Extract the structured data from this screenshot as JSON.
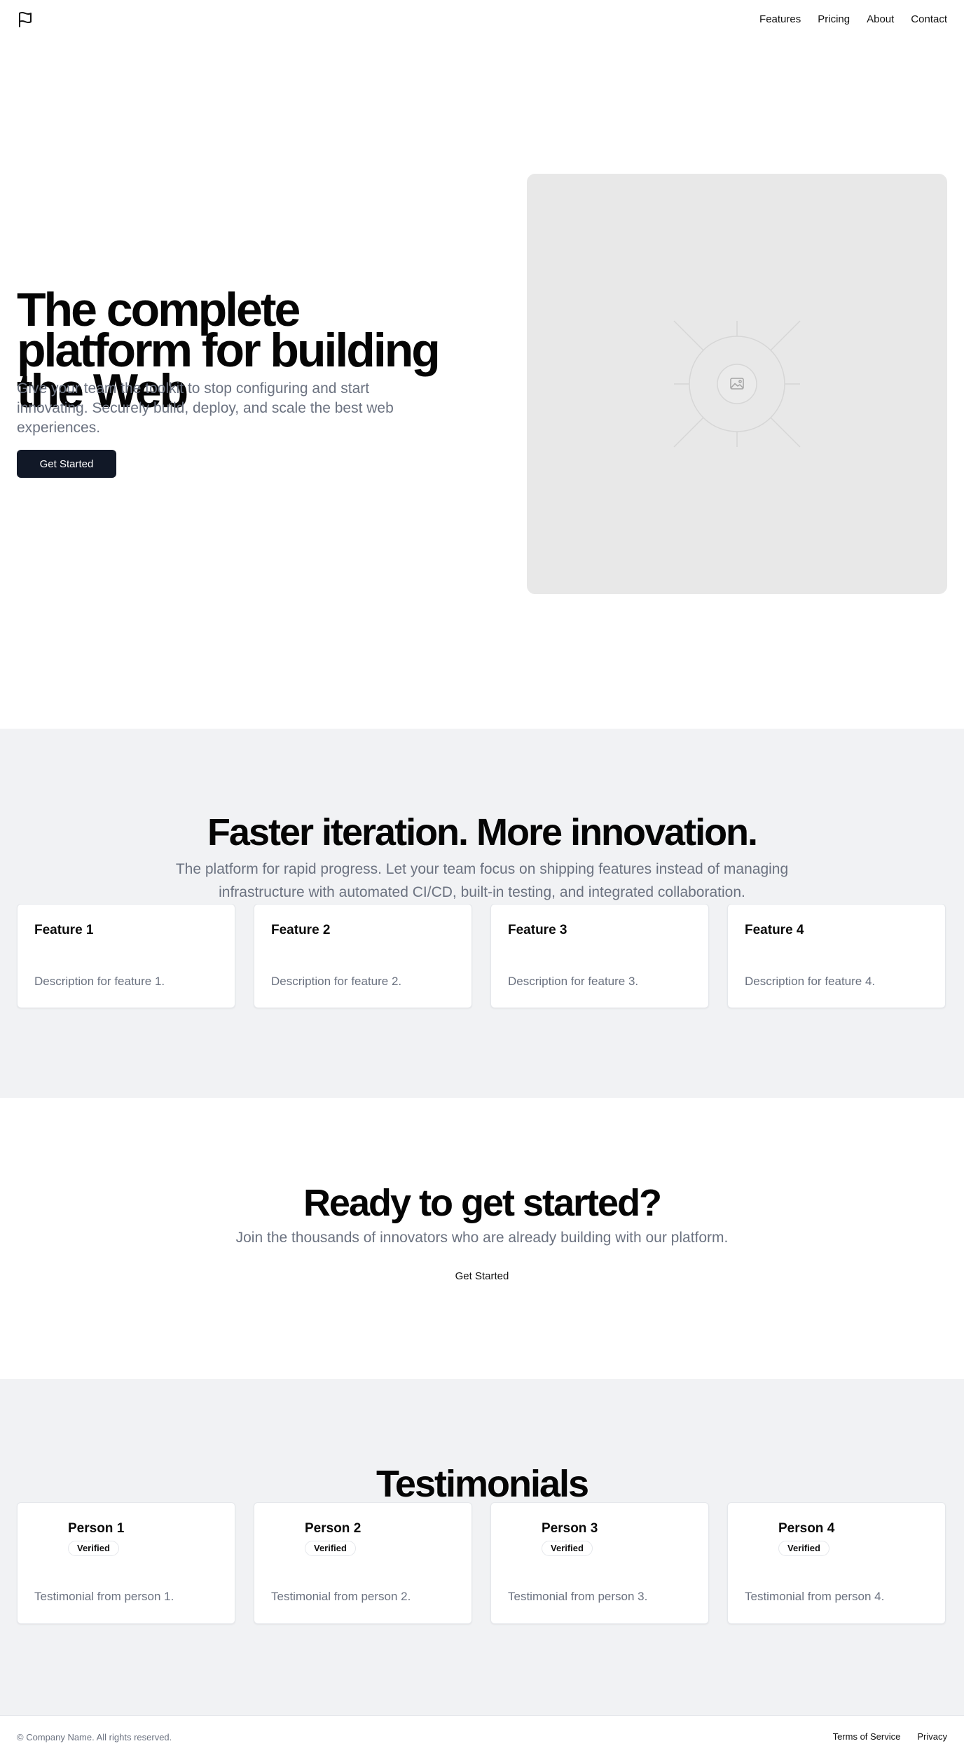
{
  "header": {
    "logo_icon": "flag-icon",
    "nav": [
      "Features",
      "Pricing",
      "About",
      "Contact"
    ]
  },
  "hero": {
    "title": "The complete platform for building the Web",
    "subtitle": "Give your team the toolkit to stop configuring and start innovating. Securely build, deploy, and scale the best web experiences.",
    "cta_label": "Get Started",
    "image_icon": "image-placeholder-icon"
  },
  "features": {
    "title": "Faster iteration. More innovation.",
    "subtitle": "The platform for rapid progress. Let your team focus on shipping features instead of managing infrastructure with automated CI/CD, built-in testing, and integrated collaboration.",
    "items": [
      {
        "title": "Feature 1",
        "description": "Description for feature 1."
      },
      {
        "title": "Feature 2",
        "description": "Description for feature 2."
      },
      {
        "title": "Feature 3",
        "description": "Description for feature 3."
      },
      {
        "title": "Feature 4",
        "description": "Description for feature 4."
      }
    ]
  },
  "cta": {
    "title": "Ready to get started?",
    "subtitle": "Join the thousands of innovators who are already building with our platform.",
    "button_label": "Get Started"
  },
  "testimonials": {
    "title": "Testimonials",
    "items": [
      {
        "name": "Person 1",
        "badge": "Verified",
        "text": "Testimonial from person 1."
      },
      {
        "name": "Person 2",
        "badge": "Verified",
        "text": "Testimonial from person 2."
      },
      {
        "name": "Person 3",
        "badge": "Verified",
        "text": "Testimonial from person 3."
      },
      {
        "name": "Person 4",
        "badge": "Verified",
        "text": "Testimonial from person 4."
      }
    ]
  },
  "footer": {
    "copyright": "© Company Name. All rights reserved.",
    "links": [
      "Terms of Service",
      "Privacy"
    ]
  },
  "colors": {
    "primary_button": "#111827",
    "muted_text": "#6b7280",
    "section_bg": "#f1f2f4",
    "placeholder_bg": "#e8e8e8"
  }
}
